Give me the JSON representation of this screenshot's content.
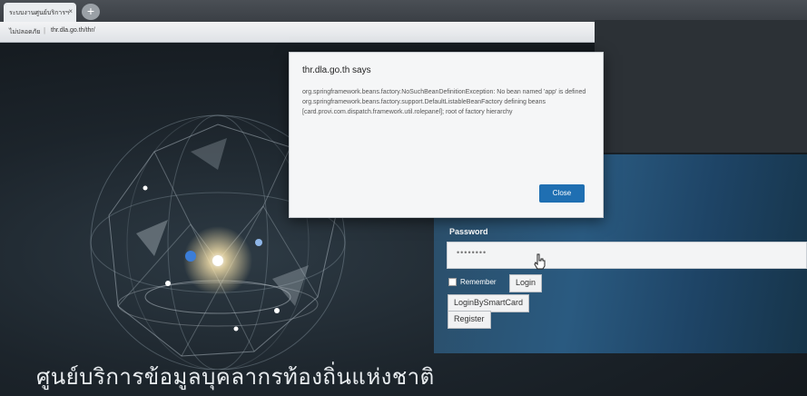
{
  "browser": {
    "tab_title": "ระบบงานศูนย์บริการฯ",
    "tab_close": "×",
    "new_tab": "+",
    "address_status": "ไม่ปลอดภัย",
    "address_separator": "|",
    "address_url": "thr.dla.go.th/thr/"
  },
  "page": {
    "title_thai": "ศูนย์บริการข้อมูลบุคลากรท้องถิ่นแห่งชาติ"
  },
  "login": {
    "password_label": "Password",
    "password_value": "••••••••",
    "remember_label": "Remember",
    "login_button": "Login",
    "login_smartcard_button": "LoginBySmartCard",
    "register_button": "Register"
  },
  "dialog": {
    "title": "thr.dla.go.th says",
    "message": "org.springframework.beans.factory.NoSuchBeanDefinitionException: No bean named 'app' is defined\norg.springframework.beans.factory.support.DefaultListableBeanFactory defining beans [card.provi.com.dispatch.framework.util.rolepanel]; root of factory hierarchy",
    "close_button": "Close"
  },
  "colors": {
    "dialog_button": "#1f6fb2",
    "panel_blue": "#2a5a80"
  }
}
